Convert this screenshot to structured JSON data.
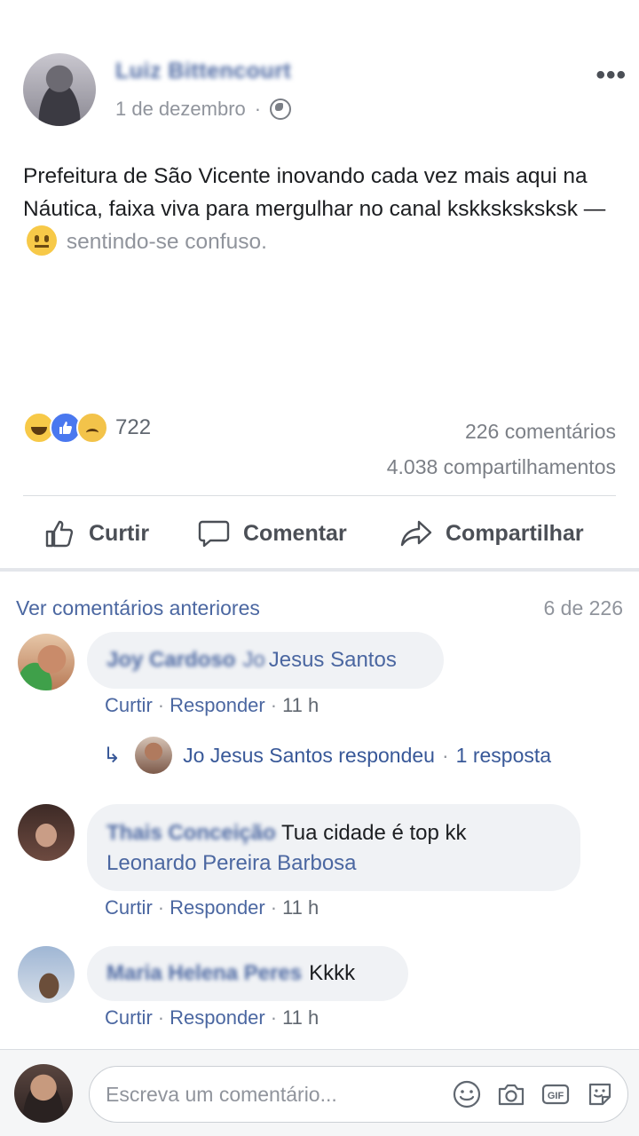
{
  "post": {
    "author": "Luiz Bittencourt",
    "date": "1 de dezembro",
    "meta_sep": "·",
    "more": "•••",
    "text": "Prefeitura de São Vicente inovando cada vez mais aqui na Náutica, faixa viva para mergulhar no canal kskksksksksk —",
    "feeling": "sentindo-se confuso."
  },
  "stats": {
    "reaction_count": "722",
    "comments": "226 comentários",
    "shares": "4.038 compartilhamentos"
  },
  "actions": {
    "like": "Curtir",
    "comment": "Comentar",
    "share": "Compartilhar"
  },
  "comments_section": {
    "see_previous": "Ver comentários anteriores",
    "count": "6 de 226",
    "items": [
      {
        "author": "Joy Cardoso",
        "tag_blur": "Jo",
        "text": "Jesus Santos",
        "like": "Curtir",
        "reply": "Responder",
        "time": "11 h"
      },
      {
        "author": "Thais Conceição",
        "text": "Tua cidade é top kk",
        "tag": "Leonardo Pereira Barbosa",
        "like": "Curtir",
        "reply": "Responder",
        "time": "11 h"
      },
      {
        "author": "Maria Helena Peres",
        "text": "Kkkk",
        "like": "Curtir",
        "reply": "Responder",
        "time": "11 h"
      }
    ],
    "reply_summary": {
      "name": "Jo Jesus Santos respondeu",
      "sep": "·",
      "count": "1 resposta"
    }
  },
  "composer": {
    "placeholder": "Escreva um comentário..."
  },
  "colors": {
    "link": "#4b67a1",
    "bubble": "#f0f2f5",
    "muted": "#90949c"
  }
}
